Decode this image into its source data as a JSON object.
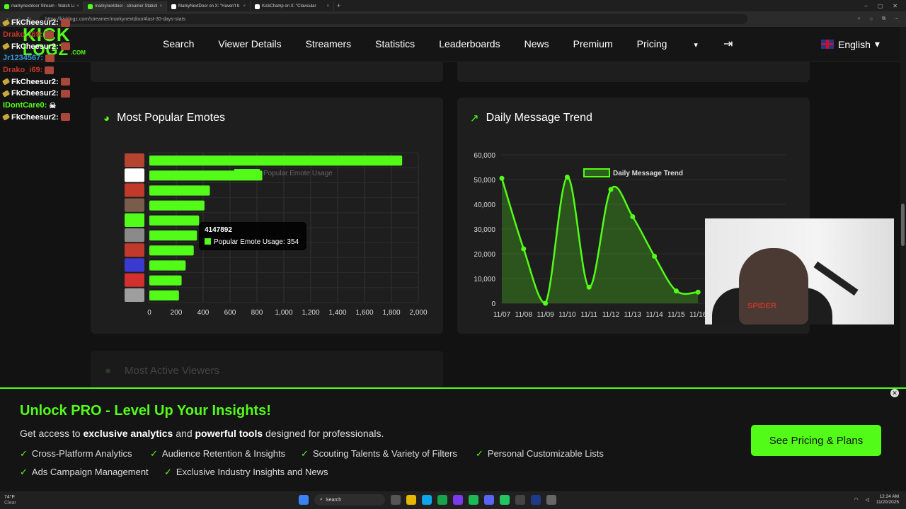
{
  "browser": {
    "tabs": [
      {
        "title": "markynextdoor Stream - Watch Li",
        "favicon_color": "#53fc18",
        "active": false
      },
      {
        "title": "markynextdoor - streamer Statisti",
        "favicon_color": "#53fc18",
        "active": true
      },
      {
        "title": "MarkyNextDoor on X: \"Haven't b",
        "favicon_color": "#ffffff",
        "active": false
      },
      {
        "title": "KickChamp on X: \"Clavicular",
        "favicon_color": "#ffffff",
        "active": false
      }
    ],
    "new_tab": "+",
    "window_controls": [
      "–",
      "▢",
      "✕"
    ],
    "url": "https://kicklogz.com/streamer/markynextdoor#last-30-days-stats"
  },
  "header": {
    "logo_line1": "KICK",
    "logo_line2": "LOGZ",
    "logo_suffix": ".COM",
    "nav": [
      "Search",
      "Viewer Details",
      "Streamers",
      "Statistics",
      "Leaderboards",
      "News",
      "Premium",
      "Pricing"
    ],
    "pricing_caret": "▾",
    "language": "English",
    "language_caret": "▾"
  },
  "chat": [
    {
      "user": "FkCheesur2:",
      "color": "#ffffff",
      "badge": true,
      "emote": true
    },
    {
      "user": "Drako_i69:",
      "color": "#c0392b",
      "badge": false,
      "emote": true
    },
    {
      "user": "FkCheesur2:",
      "color": "#ffffff",
      "badge": true,
      "emote": true
    },
    {
      "user": "Jr1234567:",
      "color": "#3498db",
      "badge": false,
      "emote": true
    },
    {
      "user": "Drako_i69:",
      "color": "#c0392b",
      "badge": false,
      "emote": true
    },
    {
      "user": "FkCheesur2:",
      "color": "#ffffff",
      "badge": true,
      "emote": true
    },
    {
      "user": "FkCheesur2:",
      "color": "#ffffff",
      "badge": true,
      "emote": true
    },
    {
      "user": "IDontCare0:",
      "color": "#53fc18",
      "badge": false,
      "emote": false
    },
    {
      "user": "FkCheesur2:",
      "color": "#ffffff",
      "badge": true,
      "emote": true
    }
  ],
  "cards": {
    "emotes_title": "Most Popular Emotes",
    "trend_title": "Daily Message Trend",
    "faded_title": "Most Active Viewers"
  },
  "chart_data": [
    {
      "type": "bar",
      "orientation": "horizontal",
      "legend": "Popular Emote Usage",
      "categories": [
        "emote-1",
        "emote-2",
        "emote-3",
        "emote-4",
        "emote-5",
        "emote-6",
        "emote-7",
        "emote-8",
        "emote-9",
        "emote-10"
      ],
      "values": [
        1880,
        840,
        450,
        410,
        370,
        354,
        330,
        270,
        240,
        220
      ],
      "xlim": [
        0,
        2000
      ],
      "xticks": [
        "0",
        "200",
        "400",
        "600",
        "800",
        "1,000",
        "1,200",
        "1,400",
        "1,600",
        "1,800",
        "2,000"
      ],
      "color": "#53fc18",
      "tooltip": {
        "title": "4147892",
        "label": "Popular Emote Usage: 354"
      }
    },
    {
      "type": "area",
      "legend": "Daily Message Trend",
      "x": [
        "11/07",
        "11/08",
        "11/09",
        "11/10",
        "11/11",
        "11/12",
        "11/13",
        "11/14",
        "11/15",
        "11/16"
      ],
      "values": [
        50500,
        22000,
        0,
        51000,
        6500,
        46000,
        35000,
        19000,
        5000,
        4500
      ],
      "ylim": [
        0,
        60000
      ],
      "yticks": [
        "0",
        "10,000",
        "20,000",
        "30,000",
        "40,000",
        "50,000",
        "60,000"
      ],
      "color": "#53fc18"
    }
  ],
  "promo": {
    "title": "Unlock PRO - Level Up Your Insights!",
    "desc_pre": "Get access to ",
    "desc_b1": "exclusive analytics",
    "desc_mid": " and ",
    "desc_b2": "powerful tools",
    "desc_post": " designed for professionals.",
    "features": [
      "Cross-Platform Analytics",
      "Audience Retention & Insights",
      "Scouting Talents & Variety of Filters",
      "Personal Customizable Lists",
      "Ads Campaign Management",
      "Exclusive Industry Insights and News"
    ],
    "cta": "See Pricing & Plans",
    "close": "✕"
  },
  "webcam": {
    "shirt_text": "SPIDER"
  },
  "taskbar": {
    "weather_temp": "74°F",
    "weather_desc": "Clear",
    "search": "Search",
    "time": "12:24 AM",
    "date": "11/20/2025"
  }
}
